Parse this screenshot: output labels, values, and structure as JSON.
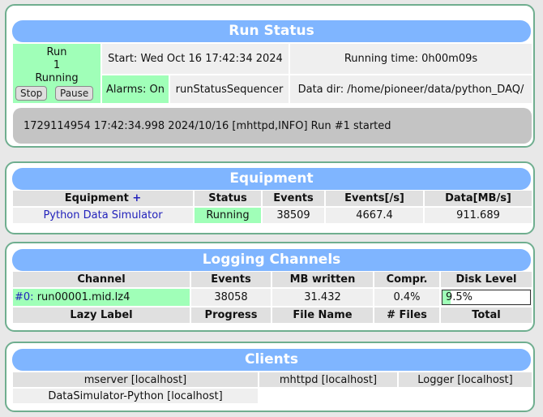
{
  "run_status": {
    "title": "Run Status",
    "run_label": "Run",
    "run_number": "1",
    "state": "Running",
    "stop_label": "Stop",
    "pause_label": "Pause",
    "start": "Start: Wed Oct 16 17:42:34 2024",
    "running_time": "Running time: 0h00m09s",
    "alarms": "Alarms: On",
    "sequencer": "runStatusSequencer",
    "data_dir": "Data dir: /home/pioneer/data/python_DAQ/",
    "message": "1729114954 17:42:34.998 2024/10/16 [mhttpd,INFO] Run #1 started"
  },
  "equipment": {
    "title": "Equipment",
    "headers": {
      "name": "Equipment",
      "add": "+",
      "status": "Status",
      "events": "Events",
      "rate": "Events[/s]",
      "data": "Data[MB/s]"
    },
    "rows": [
      {
        "name": "Python Data Simulator",
        "status": "Running",
        "events": "38509",
        "rate": "4667.4",
        "data": "911.689"
      }
    ]
  },
  "logging": {
    "title": "Logging Channels",
    "headers": [
      "Channel",
      "Events",
      "MB written",
      "Compr.",
      "Disk Level"
    ],
    "channel_id": "#0:",
    "channel_file": "run00001.mid.lz4",
    "events": "38058",
    "mb_written": "31.432",
    "compr": "0.4%",
    "disk_level": "9.5%",
    "disk_level_fraction": 0.095,
    "lazy_headers": [
      "Lazy Label",
      "Progress",
      "File Name",
      "# Files",
      "Total"
    ]
  },
  "clients": {
    "title": "Clients",
    "items": [
      "mserver [localhost]",
      "mhttpd [localhost]",
      "Logger [localhost]",
      "DataSimulator-Python [localhost]"
    ]
  },
  "colors": {
    "header": "#7fb5ff",
    "running": "#a0ffb8",
    "border": "#6fae8f"
  }
}
